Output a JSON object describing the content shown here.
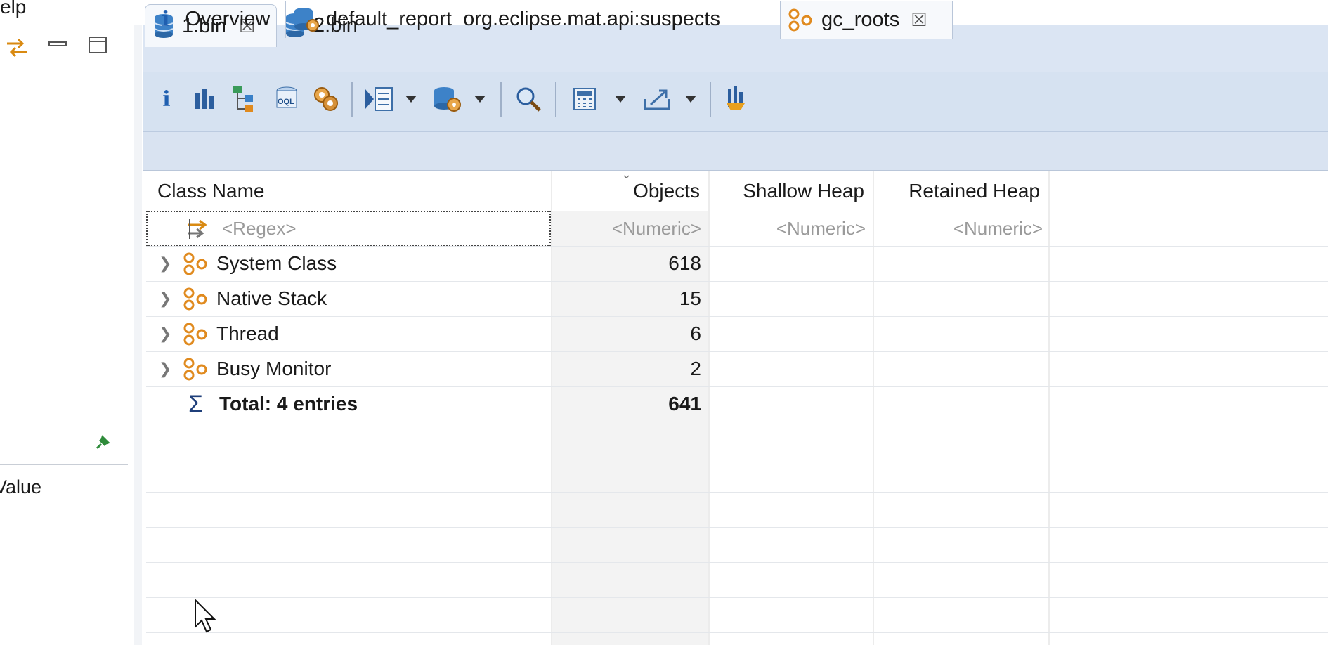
{
  "menu": {
    "help_fragment": "elp"
  },
  "left_panel": {
    "value_label": "Value"
  },
  "editor_tabs": [
    {
      "label": "1.bin"
    },
    {
      "label": "2.bin"
    }
  ],
  "toolbar": {
    "icons": [
      "info-icon",
      "histogram-icon",
      "dominator-tree-icon",
      "oql-icon",
      "heap-dump-overview-icon",
      "query-browser-icon",
      "dropdown",
      "leak-suspects-icon",
      "dropdown",
      "search-icon",
      "calculate-retained-icon",
      "dropdown",
      "export-icon",
      "dropdown",
      "group-by-icon"
    ]
  },
  "sub_tabs": {
    "overview": "Overview",
    "report": "default_report  org.eclipse.mat.api:suspects",
    "gc_roots": "gc_roots"
  },
  "table": {
    "headers": {
      "class_name": "Class Name",
      "objects": "Objects",
      "shallow_heap": "Shallow Heap",
      "retained_heap": "Retained Heap"
    },
    "filters": {
      "class_name": "<Regex>",
      "objects": "<Numeric>",
      "shallow_heap": "<Numeric>",
      "retained_heap": "<Numeric>"
    },
    "rows": [
      {
        "name": "System Class",
        "objects": "618"
      },
      {
        "name": "Native Stack",
        "objects": "15"
      },
      {
        "name": "Thread",
        "objects": "6"
      },
      {
        "name": "Busy Monitor",
        "objects": "2"
      }
    ],
    "total": {
      "label": "Total: 4 entries",
      "objects": "641"
    }
  },
  "colors": {
    "tab_bar": "#dbe5f3",
    "toolbar": "#d6e2f1",
    "gc_icon": "#e08a1e",
    "db_icon": "#2f6fb3"
  }
}
